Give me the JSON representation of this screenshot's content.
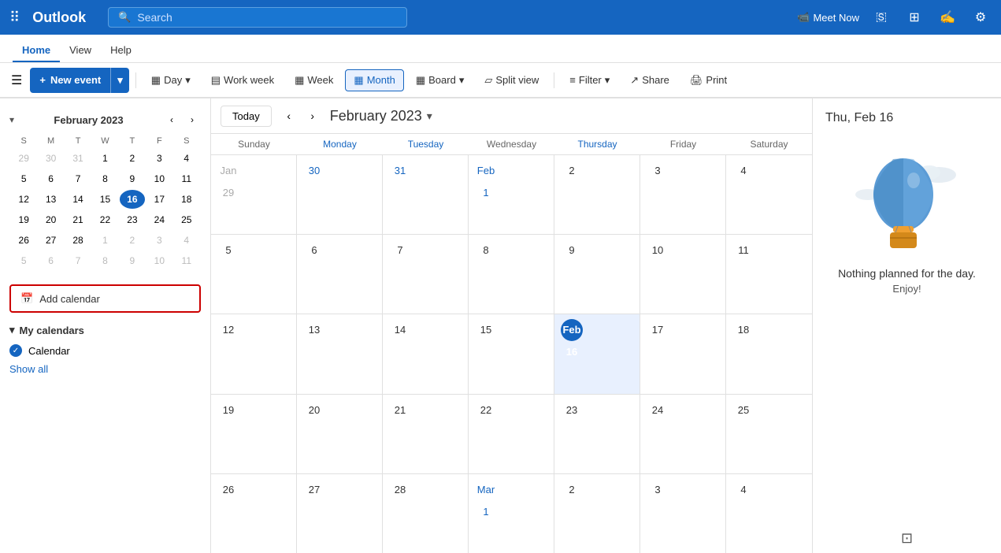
{
  "topbar": {
    "logo": "Outlook",
    "search_placeholder": "Search",
    "meet_now": "Meet Now"
  },
  "menu": {
    "items": [
      "Home",
      "View",
      "Help"
    ]
  },
  "toolbar": {
    "hamburger": "☰",
    "new_event": "New event",
    "views": [
      "Day",
      "Work week",
      "Week",
      "Month",
      "Board",
      "Split view"
    ],
    "filter": "Filter",
    "share": "Share",
    "print": "Print"
  },
  "mini_cal": {
    "title": "February 2023",
    "days_header": [
      "S",
      "M",
      "T",
      "W",
      "T",
      "F",
      "S"
    ],
    "weeks": [
      [
        {
          "n": "29",
          "other": true
        },
        {
          "n": "30",
          "other": true
        },
        {
          "n": "31",
          "other": true
        },
        {
          "n": "1"
        },
        {
          "n": "2"
        },
        {
          "n": "3"
        },
        {
          "n": "4"
        }
      ],
      [
        {
          "n": "5"
        },
        {
          "n": "6"
        },
        {
          "n": "7"
        },
        {
          "n": "8"
        },
        {
          "n": "9"
        },
        {
          "n": "10"
        },
        {
          "n": "11"
        }
      ],
      [
        {
          "n": "12"
        },
        {
          "n": "13"
        },
        {
          "n": "14"
        },
        {
          "n": "15"
        },
        {
          "n": "16",
          "today": true
        },
        {
          "n": "17"
        },
        {
          "n": "18"
        }
      ],
      [
        {
          "n": "19"
        },
        {
          "n": "20"
        },
        {
          "n": "21"
        },
        {
          "n": "22"
        },
        {
          "n": "23"
        },
        {
          "n": "24"
        },
        {
          "n": "25"
        }
      ],
      [
        {
          "n": "26"
        },
        {
          "n": "27"
        },
        {
          "n": "28"
        },
        {
          "n": "1",
          "other": true
        },
        {
          "n": "2",
          "other": true
        },
        {
          "n": "3",
          "other": true
        },
        {
          "n": "4",
          "other": true
        }
      ],
      [
        {
          "n": "5",
          "other": true
        },
        {
          "n": "6",
          "other": true
        },
        {
          "n": "7",
          "other": true
        },
        {
          "n": "8",
          "other": true
        },
        {
          "n": "9",
          "other": true
        },
        {
          "n": "10",
          "other": true
        },
        {
          "n": "11",
          "other": true
        }
      ]
    ]
  },
  "add_calendar": "Add calendar",
  "my_calendars": {
    "section_title": "My calendars",
    "items": [
      "Calendar"
    ],
    "show_all": "Show all"
  },
  "main_cal": {
    "today_btn": "Today",
    "month_title": "February 2023",
    "headers": [
      "Sunday",
      "Monday",
      "Tuesday",
      "Wednesday",
      "Thursday",
      "Friday",
      "Saturday"
    ],
    "weeks": [
      [
        {
          "n": "Jan 29",
          "other": true
        },
        {
          "n": "30",
          "blue": true
        },
        {
          "n": "31",
          "blue": true
        },
        {
          "n": "Feb 1",
          "blue": true
        },
        {
          "n": "2"
        },
        {
          "n": "3"
        },
        {
          "n": "4"
        }
      ],
      [
        {
          "n": "5"
        },
        {
          "n": "6"
        },
        {
          "n": "7"
        },
        {
          "n": "8"
        },
        {
          "n": "9"
        },
        {
          "n": "10"
        },
        {
          "n": "11"
        }
      ],
      [
        {
          "n": "12"
        },
        {
          "n": "13"
        },
        {
          "n": "14"
        },
        {
          "n": "15"
        },
        {
          "n": "Feb 16",
          "today": true
        },
        {
          "n": "17"
        },
        {
          "n": "18"
        }
      ],
      [
        {
          "n": "19"
        },
        {
          "n": "20"
        },
        {
          "n": "21"
        },
        {
          "n": "22"
        },
        {
          "n": "23"
        },
        {
          "n": "24"
        },
        {
          "n": "25"
        }
      ],
      [
        {
          "n": "26"
        },
        {
          "n": "27"
        },
        {
          "n": "28"
        },
        {
          "n": "Mar 1",
          "blue": true
        },
        {
          "n": "2"
        },
        {
          "n": "3"
        },
        {
          "n": "4"
        }
      ]
    ]
  },
  "right_panel": {
    "title": "Thu, Feb 16",
    "nothing_planned": "Nothing planned for the day.",
    "enjoy": "Enjoy!"
  }
}
